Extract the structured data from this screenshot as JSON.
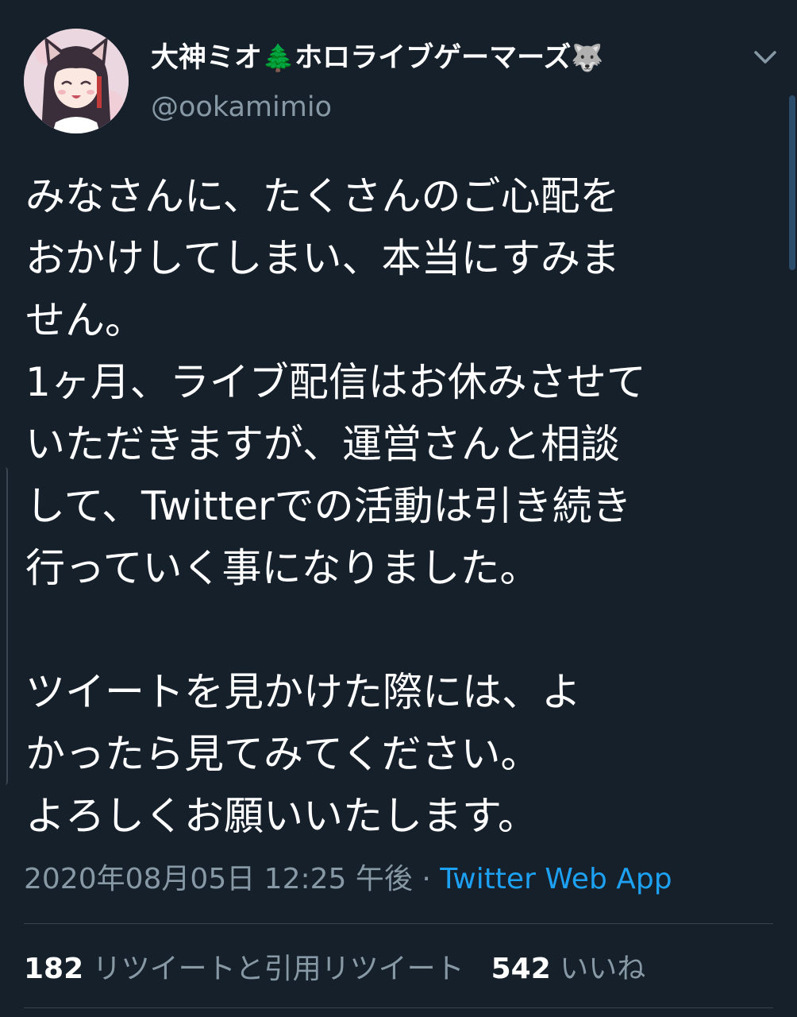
{
  "header": {
    "display_name": "大神ミオ",
    "name_middle": "ホロライブゲーマーズ",
    "tree_emoji": "🌲",
    "wolf_emoji": "🐺",
    "handle": "@ookamimio",
    "avatar_icon": "avatar-image",
    "menu_icon": "chevron-down-icon"
  },
  "tweet": {
    "paragraphs": [
      {
        "lines": [
          "みなさんに、たくさんのご心配を",
          "おかけしてしまい、本当にすみま",
          "せん。",
          "1ヶ月、ライブ配信はお休みさせて",
          "いただきますが、運営さんと相談",
          "して、Twitterでの活動は引き続き",
          "行っていく事になりました。"
        ]
      },
      {
        "lines": [
          "ツイートを見かけた際には、よ",
          "かったら見てみてください。",
          "よろしくお願いいたします。"
        ]
      }
    ]
  },
  "meta": {
    "timestamp": "2020年08月05日 12:25 午後",
    "separator": " · ",
    "source": "Twitter Web App"
  },
  "stats": {
    "retweets_count": "182",
    "retweets_label": "リツイートと引用リツイート",
    "likes_count": "542",
    "likes_label": "いいね"
  },
  "colors": {
    "background": "#15202b",
    "text": "#ffffff",
    "secondary": "#8899a6",
    "link": "#1da1f2",
    "divider": "#38444d"
  }
}
